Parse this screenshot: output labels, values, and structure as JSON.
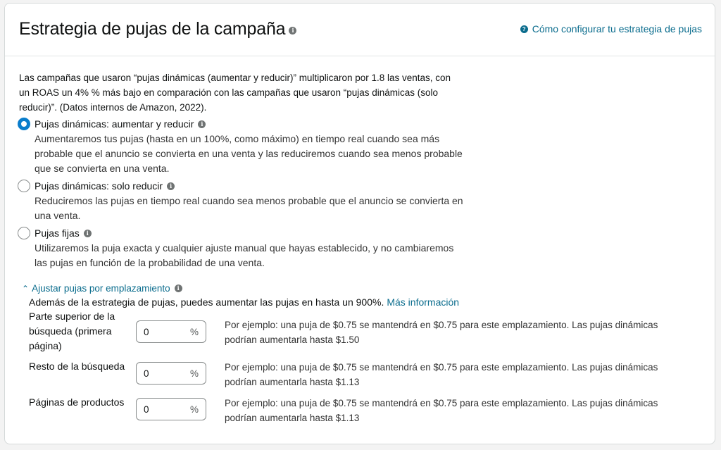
{
  "header": {
    "title": "Estrategia de pujas de la campaña",
    "help_link": "Cómo configurar tu estrategia de pujas"
  },
  "intro": "Las campañas que usaron “pujas dinámicas (aumentar y reducir)” multiplicaron por 1.8 las ventas, con un ROAS un 4% % más bajo en comparación con las campañas que usaron “pujas dinámicas (solo reducir)”. (Datos internos de Amazon, 2022).",
  "options": [
    {
      "label": "Pujas dinámicas: aumentar y reducir",
      "selected": true,
      "desc": "Aumentaremos tus pujas (hasta en un 100%, como máximo) en tiempo real cuando sea más probable que el anuncio se convierta en una venta y las reduciremos cuando sea menos probable que se convierta en una venta."
    },
    {
      "label": "Pujas dinámicas: solo reducir",
      "selected": false,
      "desc": "Reduciremos las pujas en tiempo real cuando sea menos probable que el anuncio se convierta en una venta."
    },
    {
      "label": "Pujas fijas",
      "selected": false,
      "desc": "Utilizaremos la puja exacta y cualquier ajuste manual que hayas establecido, y no cambiaremos las pujas en función de la probabilidad de una venta."
    }
  ],
  "adjust": {
    "label": "Ajustar pujas por emplazamiento",
    "desc": "Además de la estrategia de pujas, puedes aumentar las pujas en hasta un 900%.",
    "more_link": "Más información"
  },
  "placements": [
    {
      "label": "Parte superior de la búsqueda (primera página)",
      "value": "0",
      "suffix": "%",
      "desc": "Por ejemplo: una puja de $0.75 se mantendrá en $0.75 para este emplazamiento. Las pujas dinámicas podrían aumentarla hasta $1.50"
    },
    {
      "label": "Resto de la búsqueda",
      "value": "0",
      "suffix": "%",
      "desc": "Por ejemplo: una puja de $0.75 se mantendrá en $0.75 para este emplazamiento. Las pujas dinámicas podrían aumentarla hasta $1.13"
    },
    {
      "label": "Páginas de productos",
      "value": "0",
      "suffix": "%",
      "desc": "Por ejemplo: una puja de $0.75 se mantendrá en $0.75 para este emplazamiento. Las pujas dinámicas podrían aumentarla hasta $1.13"
    }
  ],
  "colors": {
    "accent": "#0a7dcc",
    "link": "#0a6c8d"
  },
  "icons": {
    "info": "info-icon",
    "help": "question-icon",
    "chevron": "chevron-up-icon"
  }
}
